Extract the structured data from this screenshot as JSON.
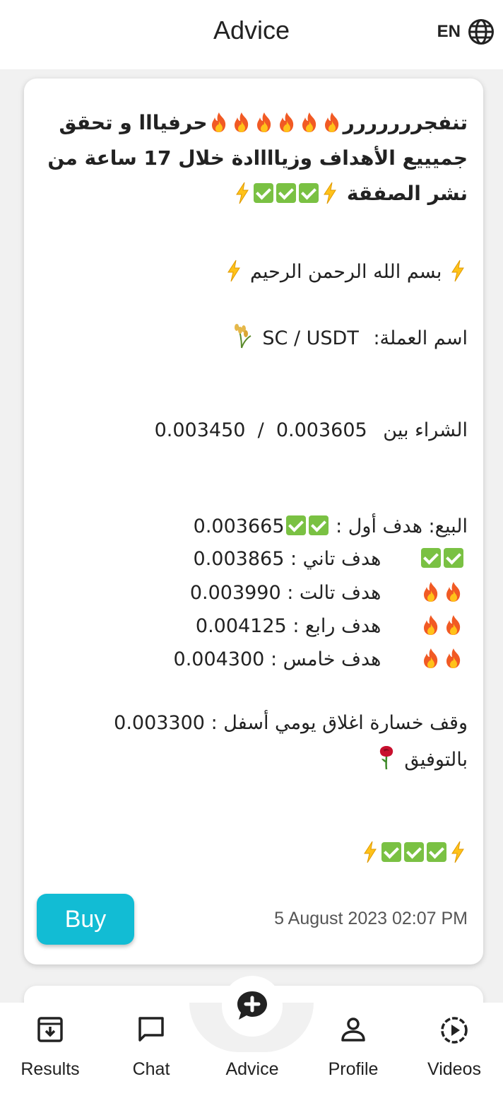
{
  "header": {
    "title": "Advice",
    "lang_code": "EN"
  },
  "post": {
    "headline_part1": "تنفجررررررر",
    "headline_part2": "حرفيااا و تحقق جميييع الأهداف وزياااادة خلال 17 ساعة من نشر الصفقة",
    "basmala": "بسم الله الرحمن الرحيم",
    "coin_label": "اسم العملة:",
    "coin_value": "SC / USDT",
    "buy_range_label": "الشراء بين",
    "buy_range_value": "0.003450  /  0.003605",
    "sell_label": "البيع:  هدف أول :",
    "target1": "0.003665",
    "target2_label": "هدف تاني : 0.003865",
    "target3_label": "هدف تالت : 0.003990",
    "target4_label": "هدف رابع : 0.004125",
    "target5_label": "هدف خامس : 0.004300",
    "stop_loss": "وقف خسارة اغلاق يومي أسفل : 0.003300",
    "good_luck": "بالتوفيق",
    "buy_button": "Buy",
    "date": "5 August 2023 02:07 PM"
  },
  "nav": [
    {
      "label": "Results",
      "icon": "archive-icon"
    },
    {
      "label": "Chat",
      "icon": "chat-icon"
    },
    {
      "label": "Advice",
      "icon": "add-comment-icon"
    },
    {
      "label": "Profile",
      "icon": "person-icon"
    },
    {
      "label": "Videos",
      "icon": "play-circle-icon"
    }
  ],
  "colors": {
    "accent": "#12bcd4",
    "check": "#7ac143",
    "fire": "#f15a24"
  }
}
